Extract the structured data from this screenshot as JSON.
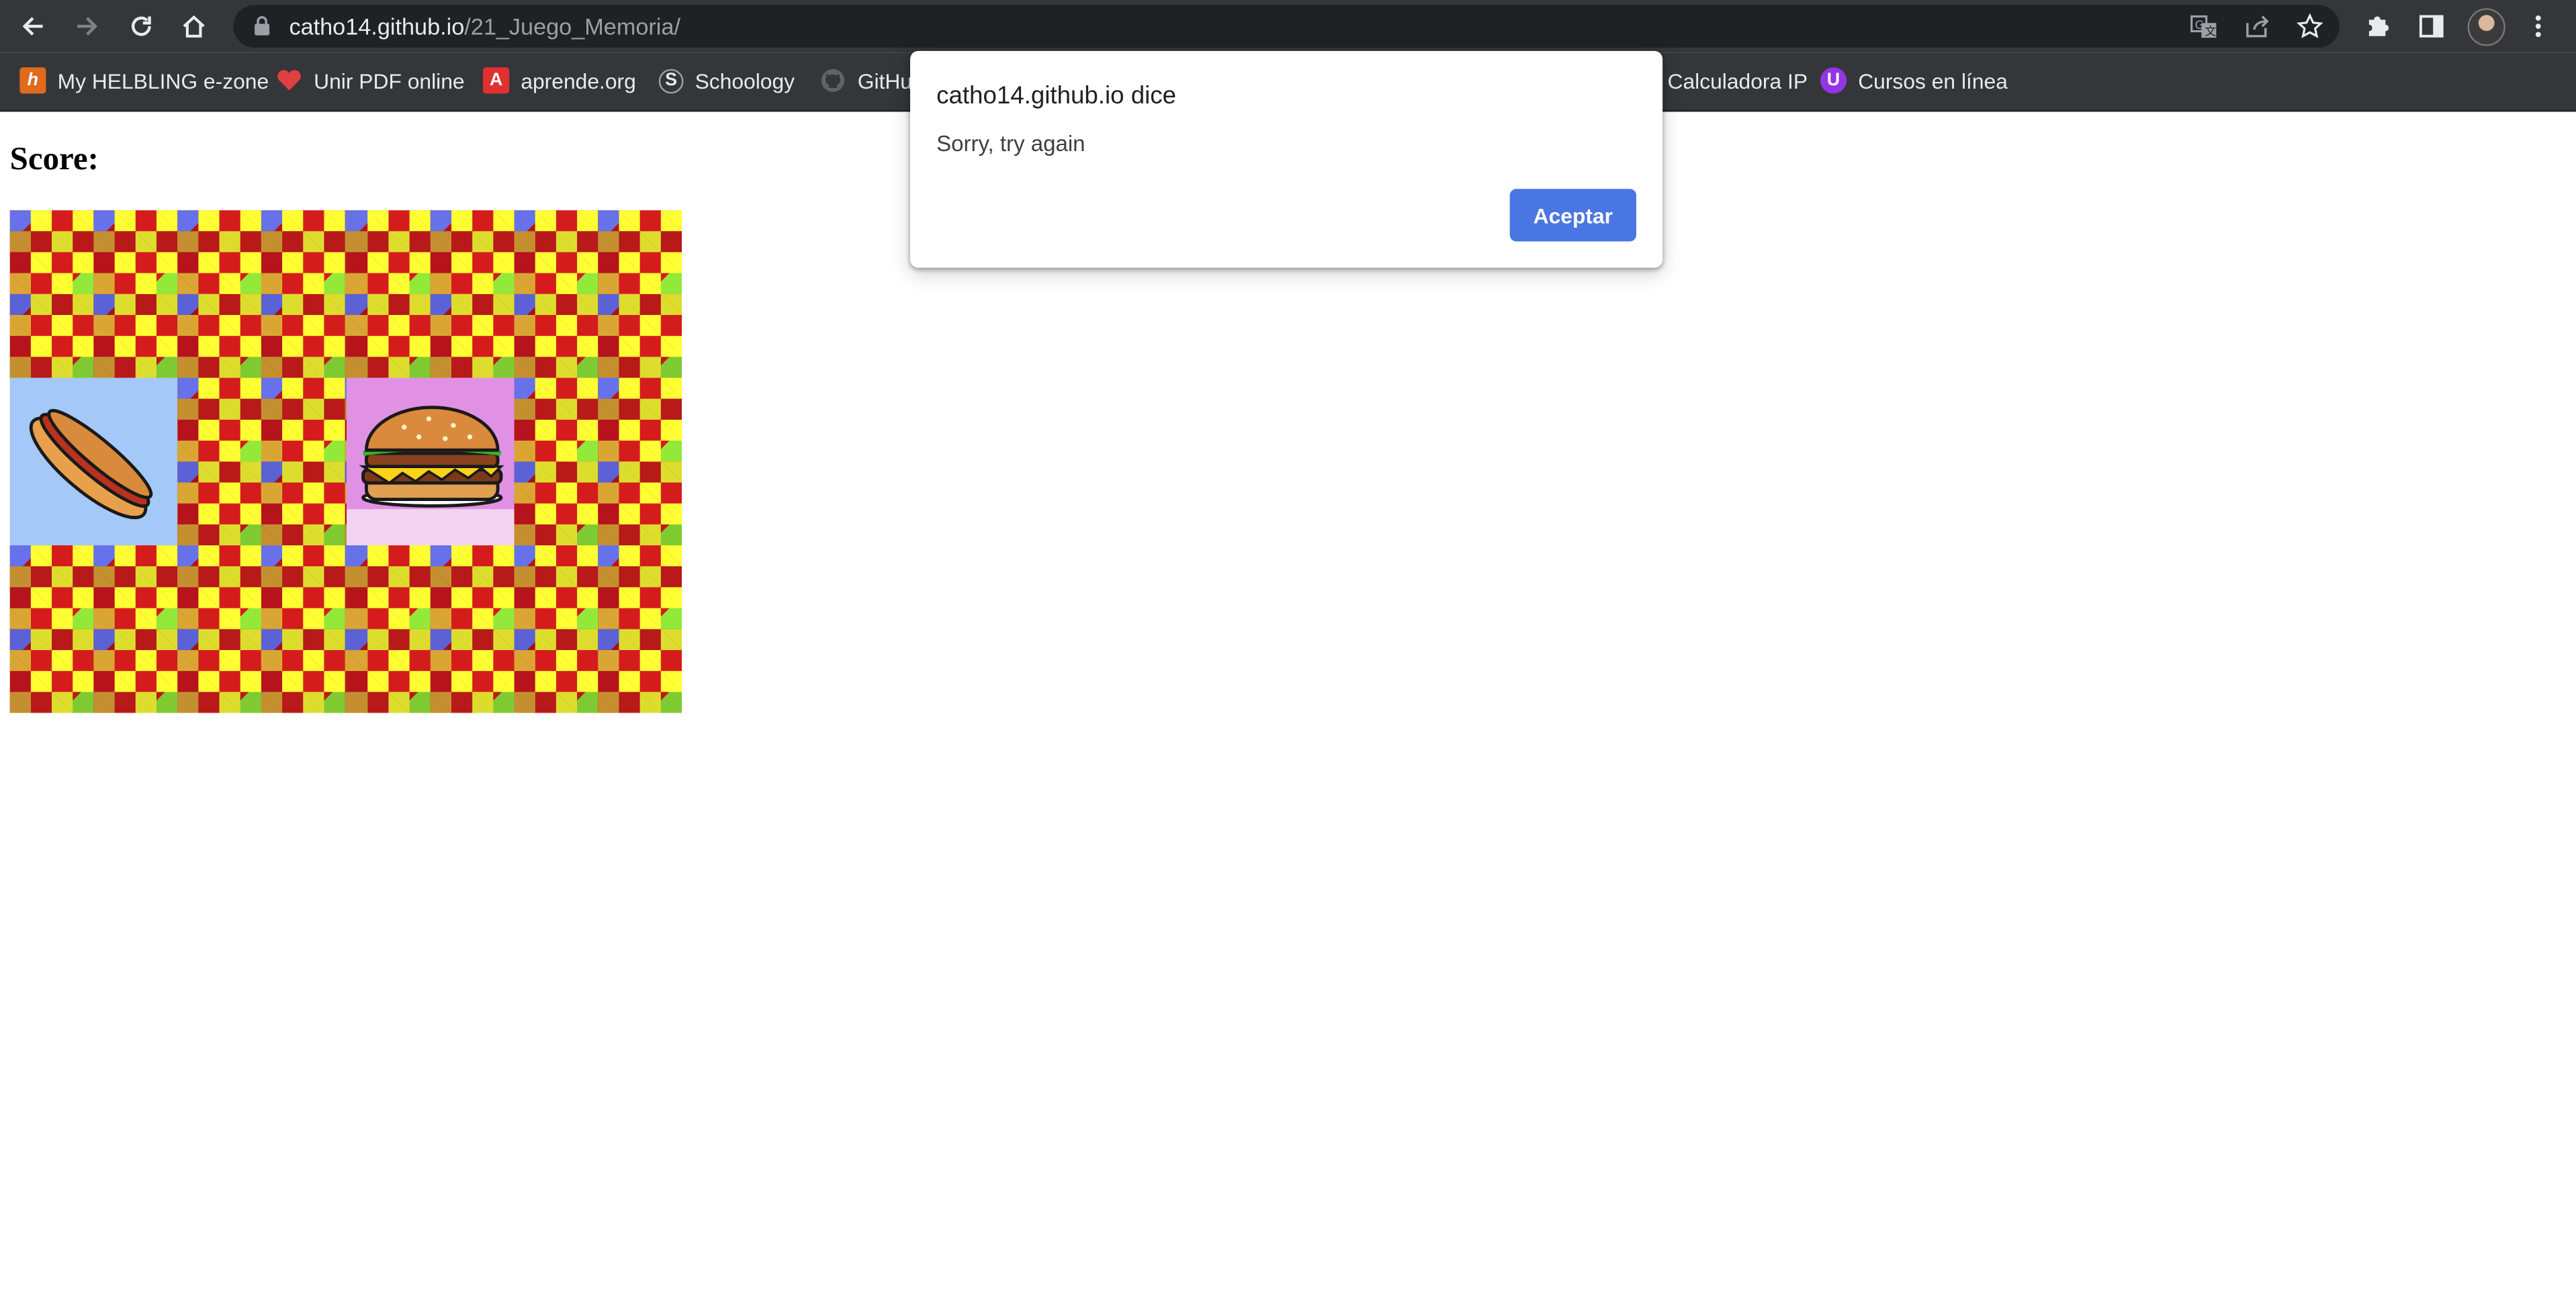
{
  "browser": {
    "url_host": "catho14.github.io",
    "url_path": "/21_Juego_Memoria/",
    "bookmarks": [
      {
        "label": "My HELBLING e-zone",
        "icon": "helbling-h-icon",
        "color": "#e06a1b"
      },
      {
        "label": "Unir PDF online",
        "icon": "heart-icon",
        "color": "#e04040"
      },
      {
        "label": "aprende.org",
        "icon": "aprende-a-icon",
        "color": "#e03030"
      },
      {
        "label": "Schoology",
        "icon": "schoology-s-icon",
        "color": "#9aa0a6"
      },
      {
        "label": "GitHu",
        "icon": "github-icon",
        "color": "#5f6368"
      },
      {
        "label": "Calculadora IP",
        "icon": "calculadora-icon",
        "color": "#35363a"
      },
      {
        "label": "Cursos en línea",
        "icon": "u-badge-icon",
        "color": "#9334e6"
      }
    ]
  },
  "page": {
    "score_label": "Score:",
    "cards": [
      {
        "state": "back"
      },
      {
        "state": "back"
      },
      {
        "state": "back"
      },
      {
        "state": "back"
      },
      {
        "state": "face",
        "image": "hotdog-icon",
        "bg": "#a4c8f7"
      },
      {
        "state": "back"
      },
      {
        "state": "face",
        "image": "hamburger-icon",
        "bg": "#e191e4"
      },
      {
        "state": "back"
      },
      {
        "state": "back"
      },
      {
        "state": "back"
      },
      {
        "state": "back"
      },
      {
        "state": "back"
      }
    ]
  },
  "dialog": {
    "title": "catho14.github.io dice",
    "message": "Sorry, try again",
    "ok_label": "Aceptar"
  },
  "colors": {
    "chrome_bg": "#35363a",
    "omnibox_bg": "#202124",
    "dialog_button": "#4a76e3"
  }
}
